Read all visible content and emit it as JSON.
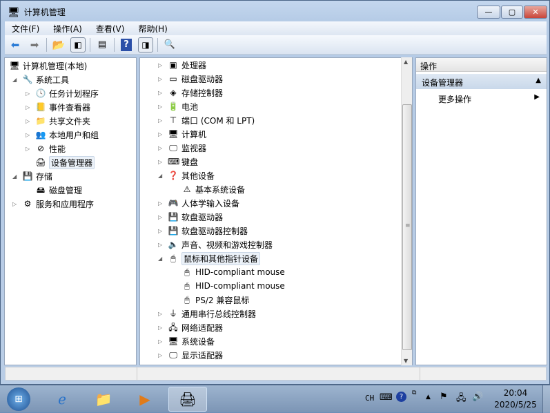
{
  "window": {
    "title": "计算机管理",
    "minimize": "—",
    "maximize": "▢",
    "close": "✕",
    "close_color": "#c9453a"
  },
  "menu": [
    "文件(F)",
    "操作(A)",
    "查看(V)",
    "帮助(H)"
  ],
  "toolbar": {
    "icons": [
      "back-icon",
      "forward-icon",
      "up-folder-icon",
      "show-hide-tree-icon",
      "properties-icon",
      "help-icon",
      "show-hide-action-pane-icon",
      "scan-hardware-icon"
    ]
  },
  "left_tree": [
    {
      "label": "计算机管理(本地)",
      "level": 0,
      "arrow": "",
      "icon": "🖥"
    },
    {
      "label": "系统工具",
      "level": 1,
      "arrow": "◢",
      "icon": "🔧"
    },
    {
      "label": "任务计划程序",
      "level": 2,
      "arrow": "▷",
      "icon": "🕓"
    },
    {
      "label": "事件查看器",
      "level": 2,
      "arrow": "▷",
      "icon": "📒"
    },
    {
      "label": "共享文件夹",
      "level": 2,
      "arrow": "▷",
      "icon": "📁"
    },
    {
      "label": "本地用户和组",
      "level": 2,
      "arrow": "▷",
      "icon": "👥"
    },
    {
      "label": "性能",
      "level": 2,
      "arrow": "▷",
      "icon": "⊘"
    },
    {
      "label": "设备管理器",
      "level": 2,
      "arrow": "",
      "icon": "🖨",
      "selected": true
    },
    {
      "label": "存储",
      "level": 1,
      "arrow": "◢",
      "icon": "💾"
    },
    {
      "label": "磁盘管理",
      "level": 2,
      "arrow": "",
      "icon": "🖴"
    },
    {
      "label": "服务和应用程序",
      "level": 1,
      "arrow": "▷",
      "icon": "⚙"
    }
  ],
  "device_tree": [
    {
      "label": "处理器",
      "level": 0,
      "arrow": "▷",
      "icon": "▣"
    },
    {
      "label": "磁盘驱动器",
      "level": 0,
      "arrow": "▷",
      "icon": "▭"
    },
    {
      "label": "存储控制器",
      "level": 0,
      "arrow": "▷",
      "icon": "◈"
    },
    {
      "label": "电池",
      "level": 0,
      "arrow": "▷",
      "icon": "🔋"
    },
    {
      "label": "端口 (COM 和 LPT)",
      "level": 0,
      "arrow": "▷",
      "icon": "⊤"
    },
    {
      "label": "计算机",
      "level": 0,
      "arrow": "▷",
      "icon": "🖥"
    },
    {
      "label": "监视器",
      "level": 0,
      "arrow": "▷",
      "icon": "🖵"
    },
    {
      "label": "键盘",
      "level": 0,
      "arrow": "▷",
      "icon": "⌨"
    },
    {
      "label": "其他设备",
      "level": 0,
      "arrow": "◢",
      "icon": "❓"
    },
    {
      "label": "基本系统设备",
      "level": 1,
      "arrow": "",
      "icon": "⚠"
    },
    {
      "label": "人体学输入设备",
      "level": 0,
      "arrow": "▷",
      "icon": "🎮"
    },
    {
      "label": "软盘驱动器",
      "level": 0,
      "arrow": "▷",
      "icon": "💾"
    },
    {
      "label": "软盘驱动器控制器",
      "level": 0,
      "arrow": "▷",
      "icon": "💾"
    },
    {
      "label": "声音、视频和游戏控制器",
      "level": 0,
      "arrow": "▷",
      "icon": "🔈"
    },
    {
      "label": "鼠标和其他指针设备",
      "level": 0,
      "arrow": "◢",
      "icon": "🖱",
      "selected": true
    },
    {
      "label": "HID-compliant mouse",
      "level": 1,
      "arrow": "",
      "icon": "🖱"
    },
    {
      "label": "HID-compliant mouse",
      "level": 1,
      "arrow": "",
      "icon": "🖱"
    },
    {
      "label": "PS/2 兼容鼠标",
      "level": 1,
      "arrow": "",
      "icon": "🖱"
    },
    {
      "label": "通用串行总线控制器",
      "level": 0,
      "arrow": "▷",
      "icon": "⏚"
    },
    {
      "label": "网络适配器",
      "level": 0,
      "arrow": "▷",
      "icon": "🖧"
    },
    {
      "label": "系统设备",
      "level": 0,
      "arrow": "▷",
      "icon": "🖥"
    },
    {
      "label": "显示适配器",
      "level": 0,
      "arrow": "▷",
      "icon": "🖵"
    }
  ],
  "actions": {
    "header": "操作",
    "section": "设备管理器",
    "section_arrow": "▲",
    "more": "更多操作",
    "more_arrow": "▶"
  },
  "taskbar": {
    "start": "start-orb",
    "apps": [
      "internet-explorer",
      "windows-explorer",
      "media-player",
      "computer-management"
    ],
    "tray": {
      "lang": "CH",
      "time": "20:04",
      "date": "2020/5/25"
    }
  }
}
